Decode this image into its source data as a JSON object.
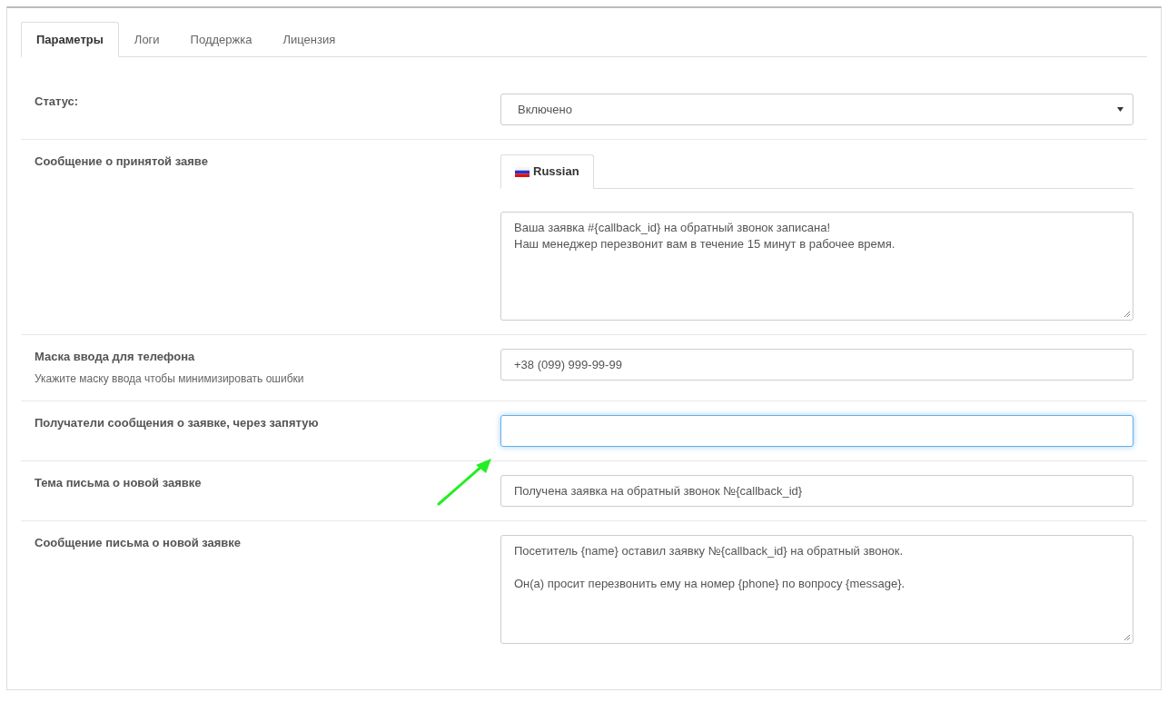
{
  "tabs": [
    {
      "label": "Параметры",
      "selected": true
    },
    {
      "label": "Логи",
      "selected": false
    },
    {
      "label": "Поддержка",
      "selected": false
    },
    {
      "label": "Лицензия",
      "selected": false
    }
  ],
  "fields": [
    {
      "kind": "select",
      "label": "Статус:",
      "value": "Включено"
    },
    {
      "kind": "multilang",
      "label": "Сообщение о принятой заяве",
      "languages": [
        {
          "label": "Russian",
          "selected": true
        }
      ],
      "value": "Ваша заявка #{callback_id} на обратный звонок записана!\nНаш менеджер перезвонит вам в течение 15 минут в рабочее время."
    },
    {
      "kind": "text",
      "label": "Маска ввода для телефона",
      "help": "Укажите маску ввода чтобы минимизировать ошибки",
      "value": "+38 (099) 999-99-99",
      "focused": false
    },
    {
      "kind": "text",
      "label": "Получатели сообщения о заявке, через запятую",
      "focused": true
    },
    {
      "kind": "text",
      "label": "Тема письма о новой заявке",
      "value": "Получена заявка на обратный звонок №{callback_id}",
      "focused": false
    },
    {
      "kind": "textarea",
      "label": "Сообщение письма о новой заявке",
      "value": "Посетитель {name} оставил заявку №{callback_id} на обратный звонок.\n\nОн(а) просит перезвонить ему на номер {phone} по вопросу {message}."
    }
  ]
}
